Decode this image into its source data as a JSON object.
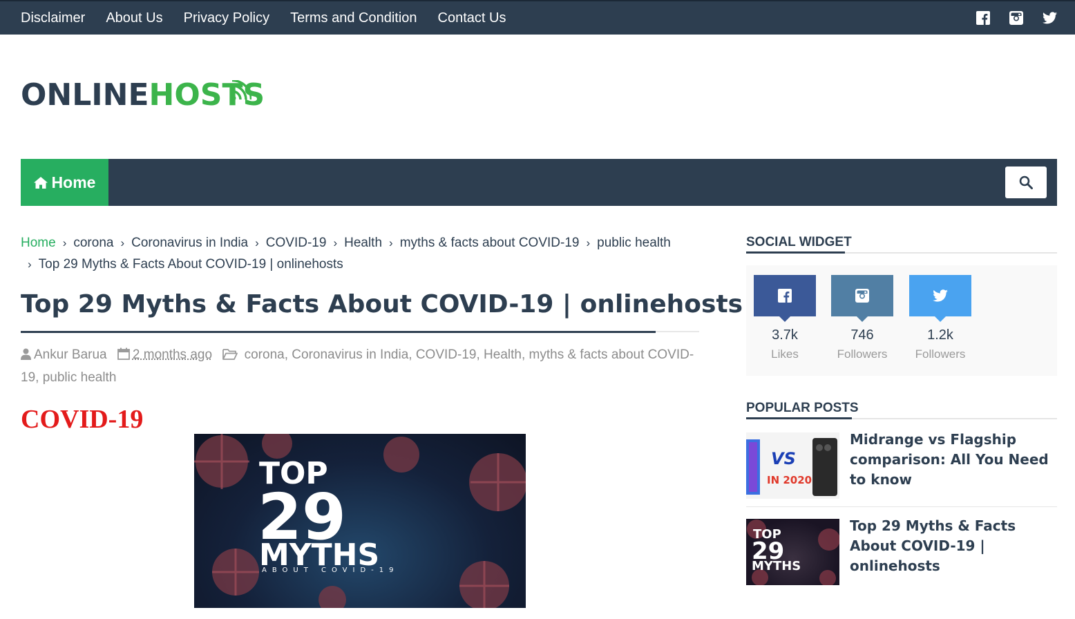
{
  "top_nav": {
    "links": [
      "Disclaimer",
      "About Us",
      "Privacy Policy",
      "Terms and Condition",
      "Contact Us"
    ],
    "social_icons": [
      "facebook-icon",
      "instagram-icon",
      "twitter-icon"
    ]
  },
  "logo": {
    "part1": "ONLINE",
    "part2": "HOSTS"
  },
  "main_nav": {
    "home_label": "Home",
    "search_icon": "search-icon"
  },
  "breadcrumb": {
    "items": [
      "Home",
      "corona",
      "Coronavirus in India",
      "COVID-19",
      "Health",
      "myths & facts about COVID-19",
      "public health",
      "Top 29 Myths & Facts About COVID-19 | onlinehosts"
    ]
  },
  "post": {
    "title": "Top 29 Myths & Facts About COVID-19 | onlinehosts",
    "author": "Ankur Barua",
    "date": "2 months ago",
    "categories": [
      "corona",
      "Coronavirus in India",
      "COVID-19",
      "Health",
      "myths & facts about COVID-19",
      "public health"
    ],
    "section_heading": "COVID-19",
    "hero": {
      "line1": "TOP",
      "line2": "29",
      "line3": "MYTHS",
      "line4": "ABOUT COVID-19"
    }
  },
  "sidebar": {
    "social_widget": {
      "title": "SOCIAL WIDGET",
      "items": [
        {
          "icon": "facebook-icon",
          "count": "3.7k",
          "label": "Likes",
          "color": "#3b5998"
        },
        {
          "icon": "instagram-icon",
          "count": "746",
          "label": "Followers",
          "color": "#517fa4"
        },
        {
          "icon": "twitter-icon",
          "count": "1.2k",
          "label": "Followers",
          "color": "#4aa3f0"
        }
      ]
    },
    "popular_posts": {
      "title": "POPULAR POSTS",
      "items": [
        {
          "title": "Midrange vs Flagship comparison: All You Need to know",
          "thumb_text_a": "VS",
          "thumb_text_b": "IN 2020"
        },
        {
          "title": "Top 29 Myths & Facts About COVID-19 | onlinehosts",
          "thumb_text_a": "TOP",
          "thumb_text_b": "29",
          "thumb_text_c": "MYTHS"
        }
      ]
    }
  },
  "colors": {
    "navy": "#2d3e50",
    "green": "#27ae60",
    "red": "#e31b1b"
  }
}
